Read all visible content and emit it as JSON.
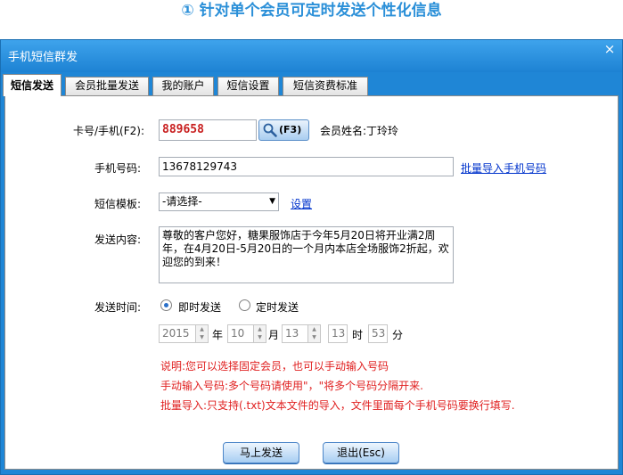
{
  "caption": "① 针对单个会员可定时发送个性化信息",
  "window": {
    "title": "手机短信群发",
    "close_glyph": "×"
  },
  "tabs": [
    {
      "label": "短信发送",
      "active": true
    },
    {
      "label": "会员批量发送",
      "active": false
    },
    {
      "label": "我的账户",
      "active": false
    },
    {
      "label": "短信设置",
      "active": false
    },
    {
      "label": "短信资费标准",
      "active": false
    }
  ],
  "form": {
    "card_label": "卡号/手机(F2):",
    "card_value": "889658",
    "search_button": "(F3)",
    "member_name": "会员姓名:丁玲玲",
    "phone_label": "手机号码:",
    "phone_value": "13678129743",
    "batch_import_link": "批量导入手机号码",
    "template_label": "短信模板:",
    "template_selected": "-请选择-",
    "settings_link": "设置",
    "content_label": "发送内容:",
    "content_value": "尊敬的客户您好，糖果服饰店于今年5月20日将开业满2周年，在4月20日-5月20日的一个月内本店全场服饰2折起，欢迎您的到来！",
    "time_label": "发送时间:",
    "radio_immediate": "即时发送",
    "radio_scheduled": "定时发送",
    "immediate_checked": true,
    "year_value": "2015",
    "year_unit": "年",
    "month_value": "10",
    "month_unit": "月",
    "day_value": "13",
    "hour_value": "13",
    "hour_unit": "时",
    "minute_value": "53",
    "minute_unit": "分"
  },
  "notes": [
    "说明:您可以选择固定会员，也可以手动输入号码",
    "手动输入号码:多个号码请使用\"，\"将多个号码分隔开来.",
    "批量导入:只支持(.txt)文本文件的导入，文件里面每个手机号码要换行填写."
  ],
  "buttons": {
    "send_now": "马上发送",
    "exit": "退出(Esc)"
  },
  "colors": {
    "title_bar": "#1f86d6",
    "caption": "#2a8fd8",
    "card_value": "#c81e1e",
    "notes": "#e02020",
    "link": "#0033cc"
  }
}
